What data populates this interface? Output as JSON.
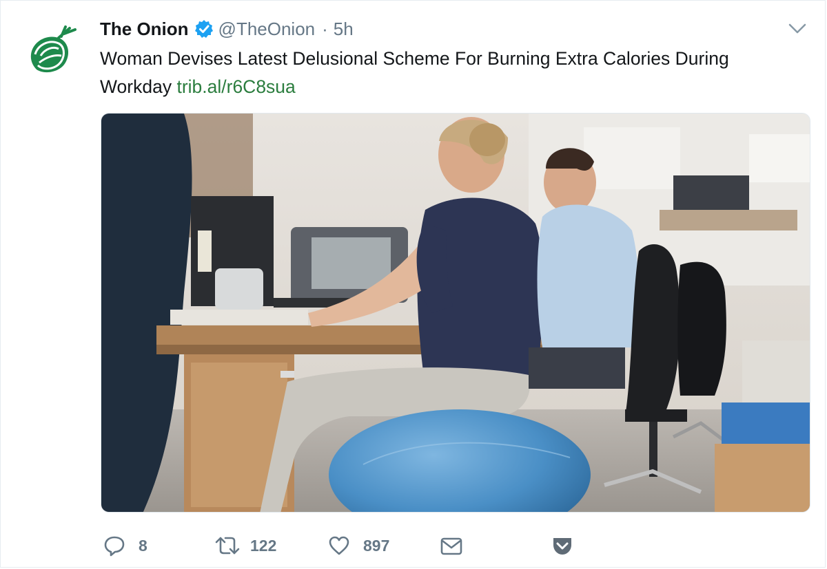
{
  "tweet": {
    "author_name": "The Onion",
    "handle": "@TheOnion",
    "separator": "·",
    "time": "5h",
    "text": "Woman Devises Latest Delusional Scheme For Burning Extra Calories During Workday",
    "link_text": "trib.al/r6C8sua"
  },
  "icons": {
    "avatar": "onion-logo-icon",
    "verified": "verified-badge-icon",
    "menu": "chevron-down-icon",
    "reply": "reply-icon",
    "retweet": "retweet-icon",
    "like": "heart-icon",
    "dm": "envelope-icon",
    "pocket": "pocket-icon"
  },
  "actions": {
    "reply_count": "8",
    "retweet_count": "122",
    "like_count": "897"
  },
  "colors": {
    "text": "#14171a",
    "secondary": "#657786",
    "link": "#2b7d3e",
    "brand_green": "#1e8a4c",
    "verified_blue": "#1da1f2"
  }
}
